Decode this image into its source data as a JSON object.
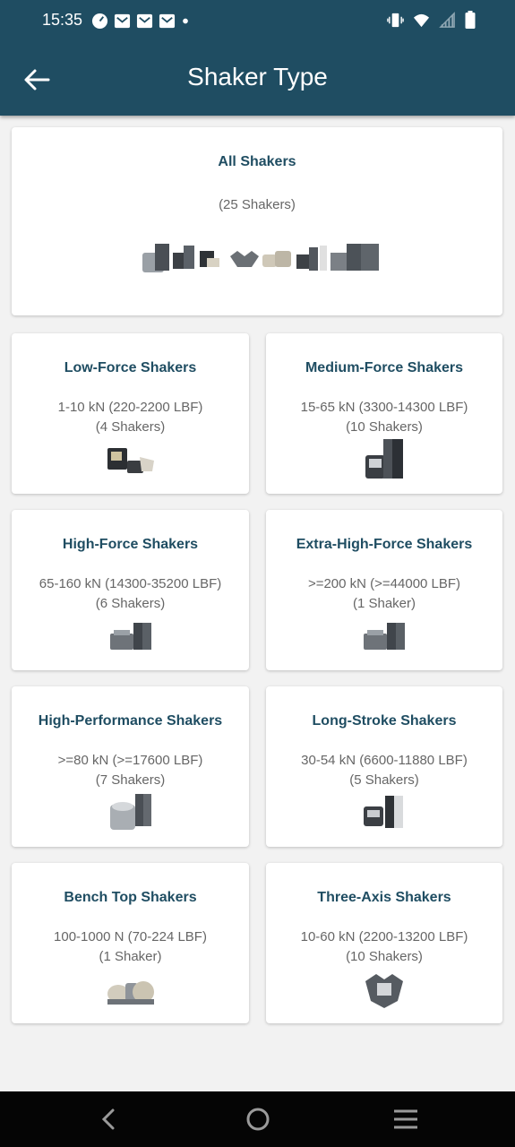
{
  "status_bar": {
    "time": "15:35",
    "left_icons": [
      "speedometer-icon",
      "mail-icon",
      "mail-icon",
      "mail-icon",
      "dot-icon"
    ],
    "right_icons": [
      "vibrate-icon",
      "wifi-icon",
      "signal-icon",
      "battery-icon"
    ]
  },
  "header": {
    "title": "Shaker Type",
    "back_icon": "arrow-left-icon"
  },
  "all_card": {
    "title": "All Shakers",
    "count": "(25 Shakers)",
    "image": "shaker-collection-image"
  },
  "cards": [
    {
      "title": "Low-Force Shakers",
      "range": "1-10 kN (220-2200 LBF)",
      "count": "(4 Shakers)",
      "image": "low-force-shaker-image"
    },
    {
      "title": "Medium-Force Shakers",
      "range": "15-65 kN (3300-14300 LBF)",
      "count": "(10 Shakers)",
      "image": "medium-force-shaker-image"
    },
    {
      "title": "High-Force Shakers",
      "range": "65-160 kN (14300-35200 LBF)",
      "count": "(6 Shakers)",
      "image": "high-force-shaker-image"
    },
    {
      "title": "Extra-High-Force Shakers",
      "range": ">=200 kN (>=44000 LBF)",
      "count": "(1 Shaker)",
      "image": "extra-high-force-shaker-image"
    },
    {
      "title": "High-Performance Shakers",
      "range": ">=80 kN (>=17600 LBF)",
      "count": "(7 Shakers)",
      "image": "high-performance-shaker-image"
    },
    {
      "title": "Long-Stroke Shakers",
      "range": "30-54 kN (6600-11880 LBF)",
      "count": "(5 Shakers)",
      "image": "long-stroke-shaker-image"
    },
    {
      "title": "Bench Top Shakers",
      "range": "100-1000 N (70-224 LBF)",
      "count": "(1 Shaker)",
      "image": "bench-top-shaker-image"
    },
    {
      "title": "Three-Axis Shakers",
      "range": "10-60 kN (2200-13200 LBF)",
      "count": "(10 Shakers)",
      "image": "three-axis-shaker-image"
    }
  ],
  "nav_bar": {
    "back": "back-nav-icon",
    "home": "home-nav-icon",
    "menu": "menu-nav-icon"
  },
  "colors": {
    "primary": "#1f4d62",
    "title_text": "#1f4d62",
    "body_text": "#666666",
    "background": "#f2f2f2",
    "nav_bar": "#050505"
  }
}
